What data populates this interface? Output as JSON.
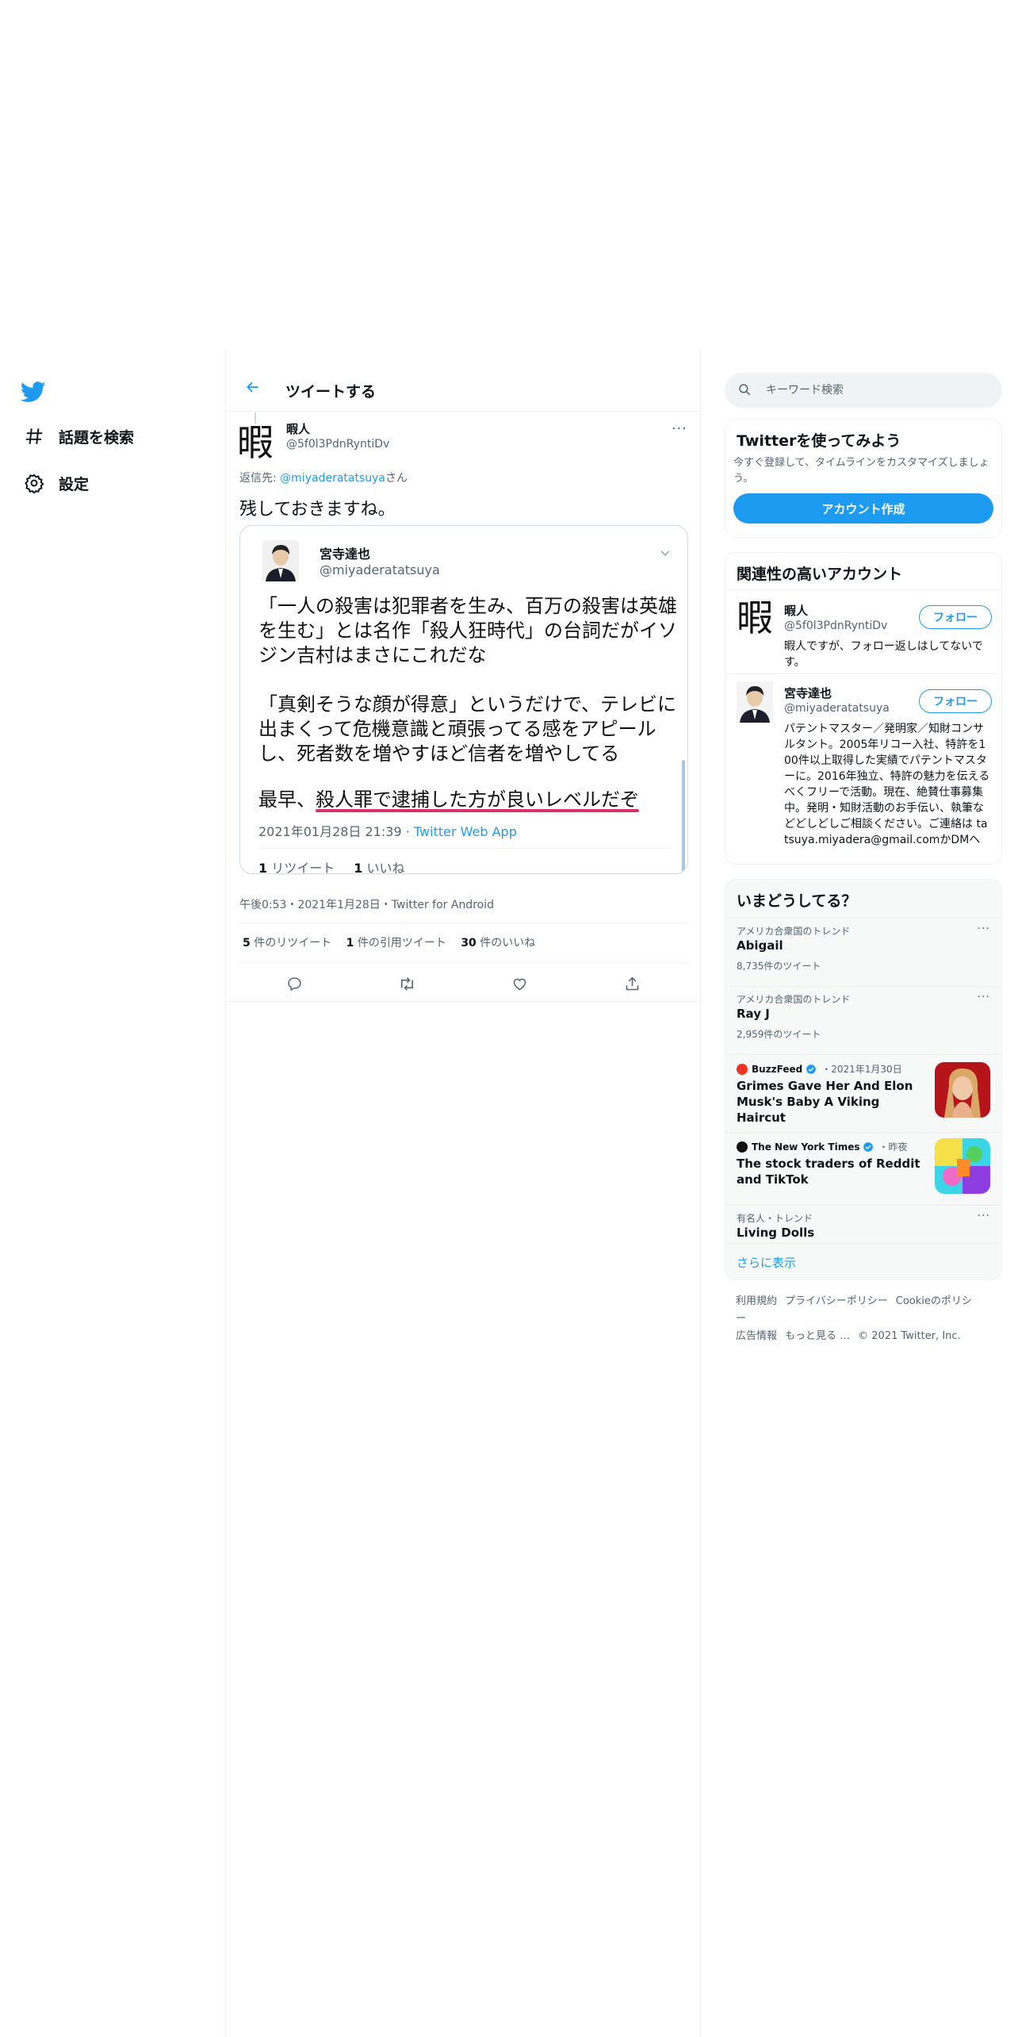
{
  "nav": {
    "items": [
      {
        "label": "話題を検索",
        "icon": "hashtag-icon"
      },
      {
        "label": "設定",
        "icon": "gear-icon"
      }
    ]
  },
  "header": {
    "title": "ツイートする"
  },
  "tweet": {
    "author_name": "暇人",
    "author_handle": "@5f0l3PdnRyntiDv",
    "avatar_char": "暇",
    "reply_prefix": "返信先: ",
    "reply_mention": "@miyaderatatsuya",
    "reply_suffix": "さん",
    "text": "残しておきますね。",
    "meta": "午後0:53・2021年1月28日・Twitter for Android",
    "stats": {
      "retweets_num": "5",
      "retweets_label": " 件のリツイート",
      "quotes_num": "1",
      "quotes_label": " 件の引用ツイート",
      "likes_num": "30",
      "likes_label": " 件のいいね"
    }
  },
  "quote": {
    "name": "宮寺達也",
    "handle": "@miyaderatatsuya",
    "para1": "「一人の殺害は犯罪者を生み、百万の殺害は英雄を生む」とは名作「殺人狂時代」の台詞だがイソジン吉村はまさにこれだな",
    "para2": "「真剣そうな顔が得意」というだけで、テレビに出まくって危機意識と頑張ってる感をアピールし、死者数を増やすほど信者を増やしてる",
    "last_prefix": "最早、",
    "last_underlined": "殺人罪で逮捕した方が良いレベルだぞ",
    "date": "2021年01月28日 21:39 · ",
    "app": "Twitter Web App",
    "retweets_num": "1",
    "retweets_label": " リツイート",
    "likes_num": "1",
    "likes_label": " いいね"
  },
  "search": {
    "placeholder": "キーワード検索"
  },
  "signup": {
    "title": "Twitterを使ってみよう",
    "subtitle": "今すぐ登録して、タイムラインをカスタマイズしましょう。",
    "button": "アカウント作成"
  },
  "relevant": {
    "title": "関連性の高いアカウント",
    "accounts": [
      {
        "name": "暇人",
        "handle": "@5f0l3PdnRyntiDv",
        "bio": "暇人ですが、フォロー返しはしてないです。",
        "follow": "フォロー",
        "avatar_char": "暇"
      },
      {
        "name": "宮寺達也",
        "handle": "@miyaderatatsuya",
        "bio": "パテントマスター／発明家／知財コンサルタント。2005年リコー入社、特許を100件以上取得した実績でパテントマスターに。2016年独立、特許の魅力を伝えるべくフリーで活動。現在、絶賛仕事募集中。発明・知財活動のお手伝い、執筆などどしどしご相談ください。ご連絡は tatsuya.miyadera@gmail.comかDMへ",
        "follow": "フォロー"
      }
    ]
  },
  "trends": {
    "title": "いまどうしてる？",
    "items": [
      {
        "context": "アメリカ合衆国のトレンド",
        "name": "Abigail",
        "count": "8,735件のツイート"
      },
      {
        "context": "アメリカ合衆国のトレンド",
        "name": "Ray J",
        "count": "2,959件のツイート"
      }
    ],
    "news": [
      {
        "source": "BuzzFeed",
        "time": "・2021年1月30日",
        "title": "Grimes Gave Her And Elon Musk's Baby A Viking Haircut",
        "dot_color": "#e32"
      },
      {
        "source": "The New York Times",
        "time": "・昨夜",
        "title": "The stock traders of Reddit and TikTok",
        "dot_color": "#111"
      }
    ],
    "last": {
      "context": "有名人・トレンド",
      "name": "Living Dolls"
    },
    "show_more": "さらに表示"
  },
  "footer": {
    "links": [
      "利用規約",
      "プライバシーポリシー",
      "Cookieのポリシー",
      "広告情報",
      "もっと見る …"
    ],
    "copyright": "© 2021 Twitter, Inc."
  },
  "colors": {
    "accent": "#1d9bf0",
    "underline": "#d9316a"
  }
}
